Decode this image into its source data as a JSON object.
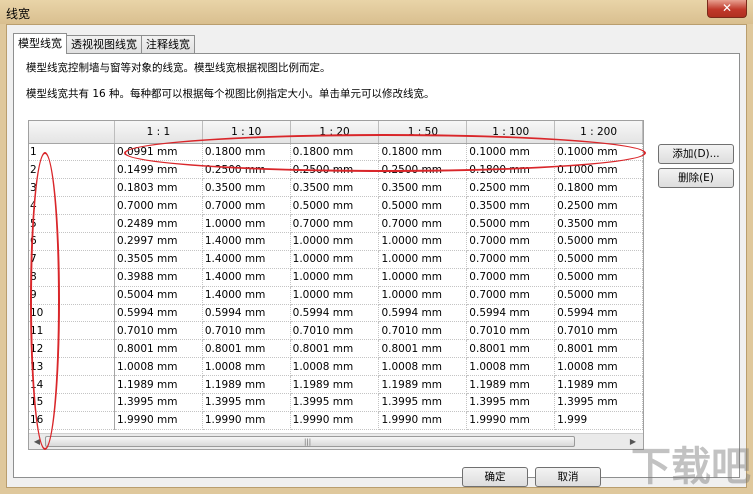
{
  "window": {
    "title": "线宽",
    "close_label": "✕"
  },
  "tabs": [
    {
      "label": "模型线宽",
      "active": true
    },
    {
      "label": "透视视图线宽"
    },
    {
      "label": "注释线宽"
    }
  ],
  "description": {
    "line1": "模型线宽控制墙与窗等对象的线宽。模型线宽根据视图比例而定。",
    "line2": "模型线宽共有 16 种。每种都可以根据每个视图比例指定大小。单击单元可以修改线宽。"
  },
  "table": {
    "columns": [
      "1 : 1",
      "1 : 10",
      "1 : 20",
      "1 : 50",
      "1 : 100",
      "1 : 200"
    ],
    "rows": [
      {
        "id": "1",
        "values": [
          "0.0991 mm",
          "0.1800 mm",
          "0.1800 mm",
          "0.1800 mm",
          "0.1000 mm",
          "0.1000 mm"
        ]
      },
      {
        "id": "2",
        "values": [
          "0.1499 mm",
          "0.2500 mm",
          "0.2500 mm",
          "0.2500 mm",
          "0.1800 mm",
          "0.1000 mm"
        ]
      },
      {
        "id": "3",
        "values": [
          "0.1803 mm",
          "0.3500 mm",
          "0.3500 mm",
          "0.3500 mm",
          "0.2500 mm",
          "0.1800 mm"
        ]
      },
      {
        "id": "4",
        "values": [
          "0.7000 mm",
          "0.7000 mm",
          "0.5000 mm",
          "0.5000 mm",
          "0.3500 mm",
          "0.2500 mm"
        ]
      },
      {
        "id": "5",
        "values": [
          "0.2489 mm",
          "1.0000 mm",
          "0.7000 mm",
          "0.7000 mm",
          "0.5000 mm",
          "0.3500 mm"
        ]
      },
      {
        "id": "6",
        "values": [
          "0.2997 mm",
          "1.4000 mm",
          "1.0000 mm",
          "1.0000 mm",
          "0.7000 mm",
          "0.5000 mm"
        ]
      },
      {
        "id": "7",
        "values": [
          "0.3505 mm",
          "1.4000 mm",
          "1.0000 mm",
          "1.0000 mm",
          "0.7000 mm",
          "0.5000 mm"
        ]
      },
      {
        "id": "8",
        "values": [
          "0.3988 mm",
          "1.4000 mm",
          "1.0000 mm",
          "1.0000 mm",
          "0.7000 mm",
          "0.5000 mm"
        ]
      },
      {
        "id": "9",
        "values": [
          "0.5004 mm",
          "1.4000 mm",
          "1.0000 mm",
          "1.0000 mm",
          "0.7000 mm",
          "0.5000 mm"
        ]
      },
      {
        "id": "10",
        "values": [
          "0.5994 mm",
          "0.5994 mm",
          "0.5994 mm",
          "0.5994 mm",
          "0.5994 mm",
          "0.5994 mm"
        ]
      },
      {
        "id": "11",
        "values": [
          "0.7010 mm",
          "0.7010 mm",
          "0.7010 mm",
          "0.7010 mm",
          "0.7010 mm",
          "0.7010 mm"
        ]
      },
      {
        "id": "12",
        "values": [
          "0.8001 mm",
          "0.8001 mm",
          "0.8001 mm",
          "0.8001 mm",
          "0.8001 mm",
          "0.8001 mm"
        ]
      },
      {
        "id": "13",
        "values": [
          "1.0008 mm",
          "1.0008 mm",
          "1.0008 mm",
          "1.0008 mm",
          "1.0008 mm",
          "1.0008 mm"
        ]
      },
      {
        "id": "14",
        "values": [
          "1.1989 mm",
          "1.1989 mm",
          "1.1989 mm",
          "1.1989 mm",
          "1.1989 mm",
          "1.1989 mm"
        ]
      },
      {
        "id": "15",
        "values": [
          "1.3995 mm",
          "1.3995 mm",
          "1.3995 mm",
          "1.3995 mm",
          "1.3995 mm",
          "1.3995 mm"
        ]
      },
      {
        "id": "16",
        "values": [
          "1.9990 mm",
          "1.9990 mm",
          "1.9990 mm",
          "1.9990 mm",
          "1.9990 mm",
          "1.999"
        ]
      }
    ]
  },
  "side_buttons": {
    "add": "添加(D)...",
    "delete": "删除(E)"
  },
  "footer": {
    "ok": "确定",
    "cancel": "取消"
  },
  "annotation_color": "#d9262a",
  "watermark": "下载吧"
}
